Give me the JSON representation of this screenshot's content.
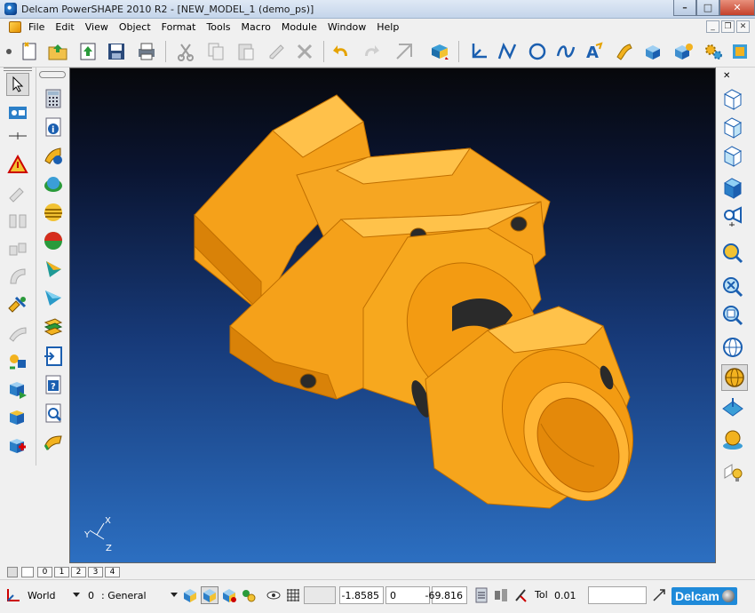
{
  "window": {
    "title": "Delcam PowerSHAPE 2010 R2 - [NEW_MODEL_1 (demo_ps)]",
    "minimize_glyph": "–",
    "maximize_glyph": "□",
    "close_glyph": "✕"
  },
  "menu": [
    "File",
    "Edit",
    "View",
    "Object",
    "Format",
    "Tools",
    "Macro",
    "Module",
    "Window",
    "Help"
  ],
  "toolbar_icons": [
    "new-file-icon",
    "open-folder-icon",
    "import-icon",
    "save-icon",
    "print-icon",
    "cut-icon",
    "copy-icon",
    "paste-icon",
    "edit-pencil-icon",
    "delete-icon",
    "undo-icon",
    "redo-icon",
    "measure-icon",
    "select-filter-icon",
    "workplane-icon",
    "line-icon",
    "circle-icon",
    "curve-icon",
    "text-icon",
    "surface-icon",
    "solid-block-icon",
    "solid-modeling-icon",
    "settings-gears-icon",
    "options-icon"
  ],
  "left_tools": [
    "select-icon",
    "general-edit-icon",
    "pin-icon",
    "warning-icon",
    "repair-icon",
    "split-icon",
    "join-icon",
    "fillet-icon",
    "assembly-icon",
    "sketch-icon",
    "analysis-icon",
    "solid-icon",
    "feature-icon",
    "calculator-icon",
    "info-icon",
    "surface-info-icon",
    "sphere-icon",
    "striped-sphere-icon",
    "shade-icon",
    "cone-icon",
    "triangle-icon",
    "layers-icon",
    "import-page-icon",
    "help-page-icon",
    "search-page-icon",
    "fold-icon"
  ],
  "right_views": [
    "view-iso1-icon",
    "view-iso2-icon",
    "view-iso3-icon",
    "view-iso4-icon",
    "view-camera-icon",
    "zoom-fit-icon",
    "zoom-box-icon",
    "zoom-out-icon",
    "wireframe-icon",
    "shaded-icon",
    "plane-icon",
    "material-sphere-icon",
    "lighting-icon"
  ],
  "axes": {
    "x": "X",
    "y": "Y",
    "z": "Z"
  },
  "pages": [
    "0",
    "1",
    "2",
    "3",
    "4"
  ],
  "status": {
    "workplane": "World",
    "level_number": "0",
    "level_name": ": General",
    "coord_x": "-1.8585",
    "coord_y": "0",
    "coord_z": "-69.816",
    "tol_label": "Tol",
    "tol_value": "0.01",
    "brand": "Delcam"
  },
  "colors": {
    "model_orange": "#f6a21a",
    "model_shadow": "#d57d0a",
    "model_highlight": "#ffc24a",
    "viewport_top": "#07080b",
    "viewport_bottom": "#2c6fc1",
    "brand_blue": "#1f8ad9"
  }
}
